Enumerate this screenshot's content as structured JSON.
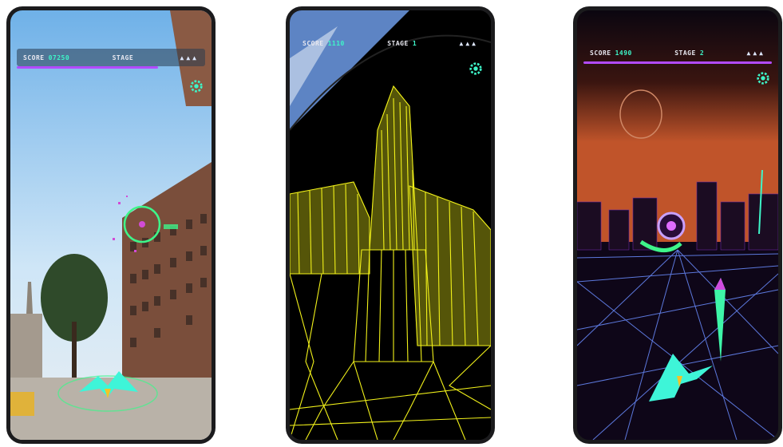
{
  "phones": [
    {
      "hud": {
        "score_label": "SCORE",
        "score_value": "07250",
        "stage_label": "STAGE",
        "stage_value": "",
        "lives": "▲▲▲"
      },
      "progress": 0.75
    },
    {
      "hud": {
        "score_label": "SCORE",
        "score_value": "1110",
        "stage_label": "STAGE",
        "stage_value": "1",
        "lives": "▲▲▲"
      },
      "progress": 0.0
    },
    {
      "hud": {
        "score_label": "SCORE",
        "score_value": "1490",
        "stage_label": "STAGE",
        "stage_value": "2",
        "lives": "▲▲▲"
      },
      "progress": 1.0
    }
  ],
  "colors": {
    "accent_cyan": "#3ef5c8",
    "accent_purple": "#b34bff",
    "wireframe_yellow": "#f2f21a",
    "grid_blue": "#6a8cff"
  },
  "icons": [
    "settings-gear-icon",
    "player-ship-icon",
    "reticle-icon",
    "life-ship-icon"
  ]
}
